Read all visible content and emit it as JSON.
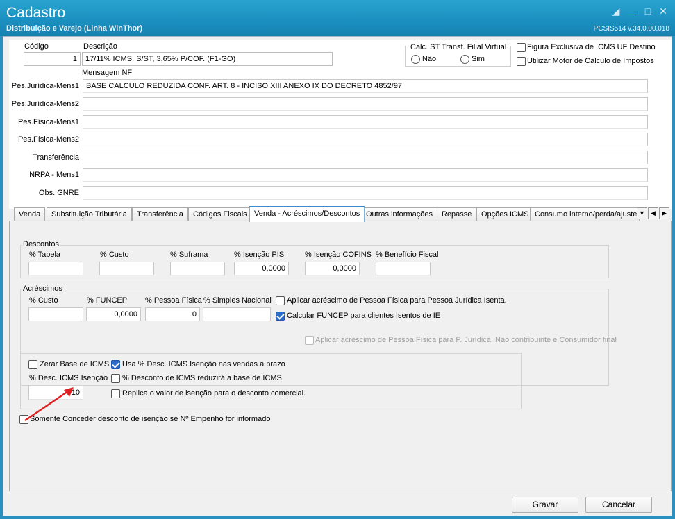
{
  "window": {
    "title": "Cadastro",
    "subtitle": "Distribuição e Varejo (Linha WinThor)",
    "version": "PCSIS514  v.34.0.00.018"
  },
  "header": {
    "codigo_label": "Código",
    "codigo_value": "1",
    "descricao_label": "Descrição",
    "descricao_value": "17/11% ICMS, S/ST, 3,65% P/COF. (F1-GO)",
    "calc_st_group": "Calc. ST Transf. Filial Virtual",
    "radio_nao": "Não",
    "radio_sim": "Sim",
    "figura_exclusiva": "Figura Exclusiva de ICMS UF Destino",
    "utilizar_motor": "Utilizar Motor de Cálculo de Impostos",
    "mensagem_nf": "Mensagem NF"
  },
  "messages": [
    {
      "label": "Pes.Jurídica-Mens1",
      "value": "BASE CALCULO REDUZIDA CONF. ART. 8 - INCISO XIII ANEXO IX DO DECRETO 4852/97"
    },
    {
      "label": "Pes.Jurídica-Mens2",
      "value": ""
    },
    {
      "label": "Pes.Física-Mens1",
      "value": ""
    },
    {
      "label": "Pes.Física-Mens2",
      "value": ""
    },
    {
      "label": "Transferência",
      "value": ""
    },
    {
      "label": "NRPA - Mens1",
      "value": ""
    },
    {
      "label": "Obs. GNRE",
      "value": ""
    }
  ],
  "tabs": [
    "Venda",
    "Substituição Tributária",
    "Transferência",
    "Códigos Fiscais",
    "Venda - Acréscimos/Descontos",
    "Outras informações",
    "Repasse",
    "Opções ICMS",
    "Consumo interno/perda/ajuste"
  ],
  "descontos": {
    "title": "Descontos",
    "fields": [
      {
        "label": "% Tabela",
        "value": ""
      },
      {
        "label": "% Custo",
        "value": ""
      },
      {
        "label": "% Suframa",
        "value": ""
      },
      {
        "label": "% Isenção PIS",
        "value": "0,0000"
      },
      {
        "label": "% Isenção COFINS",
        "value": "0,0000"
      },
      {
        "label": "% Benefício Fiscal",
        "value": ""
      }
    ]
  },
  "acrescimos": {
    "title": "Acréscimos",
    "fields": [
      {
        "label": "% Custo",
        "value": ""
      },
      {
        "label": "% FUNCEP",
        "value": "0,0000"
      },
      {
        "label": "% Pessoa Física",
        "value": "0"
      },
      {
        "label": "% Simples Nacional",
        "value": ""
      }
    ],
    "aplicar_pf_pj": "Aplicar acréscimo de Pessoa Física para Pessoa Jurídica Isenta.",
    "calcular_funcep": "Calcular FUNCEP para clientes Isentos de IE",
    "aplicar_pf_nc": "Aplicar acréscimo de Pessoa Física para P. Jurídica, Não contribuinte e Consumidor final"
  },
  "icms": {
    "zerar_base": "Zerar Base de ICMS",
    "usa_desc": "Usa % Desc. ICMS Isenção nas vendas a prazo",
    "desc_label": "% Desc. ICMS Isenção",
    "desc_value": "10",
    "desconto_reduzira": "% Desconto de ICMS reduzirá a base de ICMS.",
    "replica": "Replica o valor de isenção para o desconto comercial."
  },
  "somente_conceder": "Somente Conceder desconto de isenção se Nº Empenho for informado",
  "buttons": {
    "gravar": "Gravar",
    "cancelar": "Cancelar"
  },
  "colors": {
    "titlebar": "#1a8fbf",
    "checkbox_checked": "#2d6bc8",
    "active_tab_accent": "#3a8ad0",
    "annotation_arrow": "#e02020"
  }
}
